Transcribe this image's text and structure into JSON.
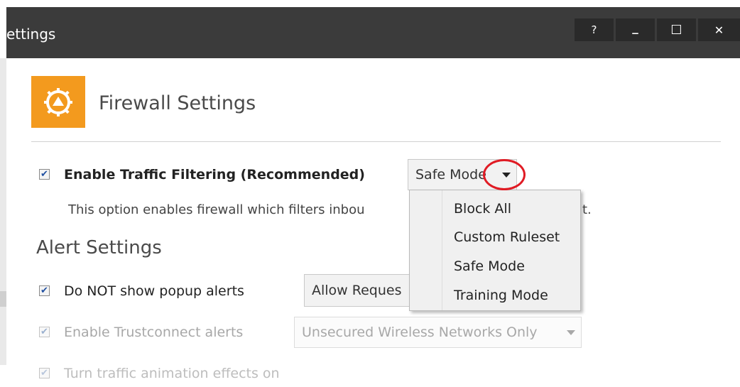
{
  "window": {
    "title": "ettings",
    "help_label": "?",
    "minimize_label": "_",
    "maximize_label": "☐",
    "close_label": "✕"
  },
  "header": {
    "title": "Firewall Settings",
    "icon": "firewall-shield-icon",
    "icon_color": "#f39a1e"
  },
  "traffic_filtering": {
    "checked": true,
    "label": "Enable Traffic Filtering (Recommended)",
    "mode_value": "Safe Mode",
    "description": "This option enables firewall which filters inbou",
    "description_tail": "t.",
    "mode_options": [
      "Block All",
      "Custom Ruleset",
      "Safe Mode",
      "Training Mode"
    ]
  },
  "alert_settings": {
    "heading": "Alert Settings",
    "popup_alerts": {
      "checked": true,
      "label": "Do NOT show popup alerts",
      "value": "Allow Reques"
    },
    "trustconnect": {
      "checked": true,
      "disabled": true,
      "label": "Enable Trustconnect alerts",
      "value": "Unsecured Wireless Networks Only"
    },
    "animation": {
      "checked": true,
      "disabled": true,
      "label": "Turn traffic animation effects on"
    }
  },
  "colors": {
    "titlebar": "#3b3b3b",
    "accent_orange": "#f39a1e",
    "highlight_red": "#e01b24"
  }
}
